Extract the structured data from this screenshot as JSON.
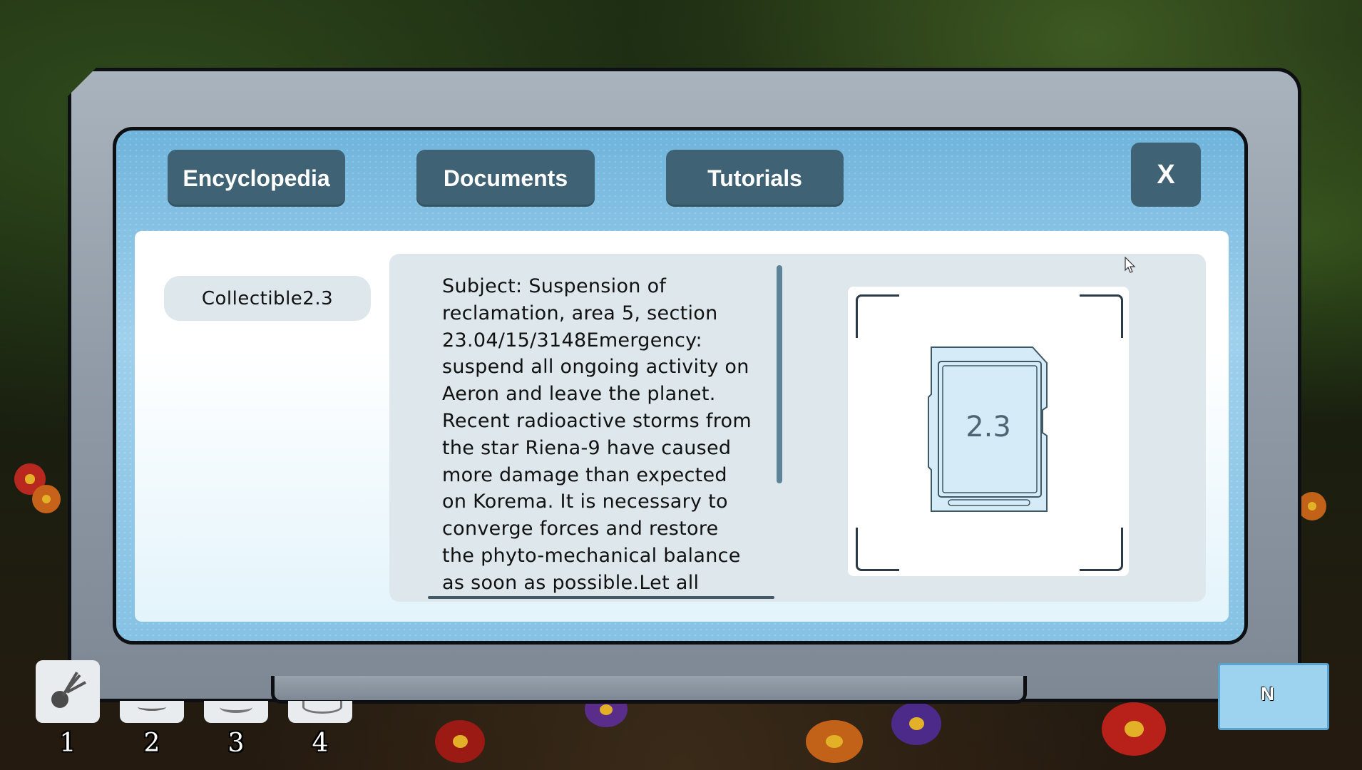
{
  "tabs": {
    "encyclopedia": "Encyclopedia",
    "documents": "Documents",
    "tutorials": "Tutorials",
    "close": "X"
  },
  "list": {
    "items": [
      {
        "label": "Collectible2.3"
      }
    ]
  },
  "document": {
    "body": "Subject: Suspension of reclamation, area 5, section 23.04/15/3148Emergency: suspend all ongoing activity on Aeron and leave the planet. Recent radioactive storms from the star Riena-9 have caused more damage than expected on Korema. It is necessary to converge forces and restore the phyto-mechanical balance as soon as possible.Let all"
  },
  "preview": {
    "card_label": "2.3",
    "icon": "sd-card-icon"
  },
  "hotbar": {
    "slots": [
      {
        "number": "1",
        "icon": "plant-tool-icon"
      },
      {
        "number": "2",
        "icon": "tool-icon"
      },
      {
        "number": "3",
        "icon": "tool-icon"
      },
      {
        "number": "4",
        "icon": "rock-icon"
      }
    ]
  },
  "minimap": {
    "compass": "N"
  },
  "colors": {
    "button_bg": "#3f6374",
    "inner_frame": "#86c2e4",
    "panel_bg": "#dde7ec"
  }
}
